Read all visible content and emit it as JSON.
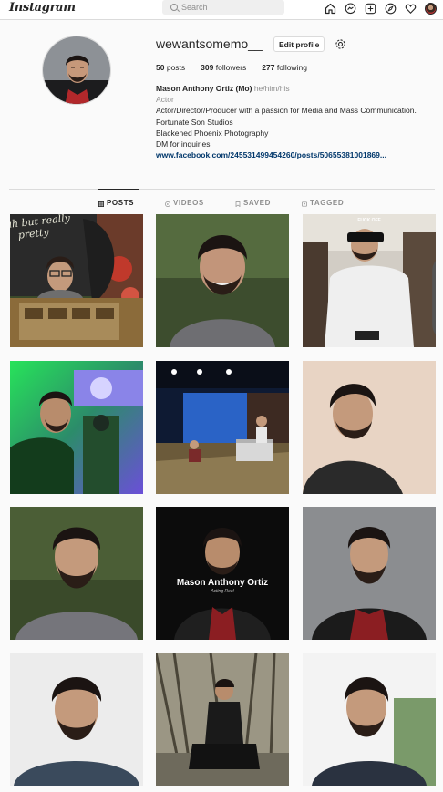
{
  "nav": {
    "logo": "Instagram",
    "search_placeholder": "Search",
    "icons": [
      "home-icon",
      "messenger-icon",
      "new-post-icon",
      "explore-icon",
      "activity-heart-icon",
      "profile-avatar-icon"
    ]
  },
  "profile": {
    "username": "wewantsomemo__",
    "edit_label": "Edit profile",
    "posts_count": "50",
    "posts_label": "posts",
    "followers_count": "309",
    "followers_label": "followers",
    "following_count": "277",
    "following_label": "following",
    "full_name": "Mason Anthony Ortiz (Mo)",
    "pronouns": "he/him/his",
    "category": "Actor",
    "bio_lines": [
      "Actor/Director/Producer with a passion for Media and Mass Communication.",
      "Fortunate Son Studios",
      "Blackened Phoenix Photography",
      "DM for inquiries"
    ],
    "link": "www.facebook.com/245531499454260/posts/50655381001869..."
  },
  "tabs": [
    {
      "label": "POSTS",
      "icon": "grid-icon",
      "active": true
    },
    {
      "label": "VIDEOS",
      "icon": "video-icon",
      "active": false
    },
    {
      "label": "SAVED",
      "icon": "bookmark-icon",
      "active": false
    },
    {
      "label": "TAGGED",
      "icon": "tag-icon",
      "active": false
    }
  ],
  "posts": [
    {
      "caption": "yeah but really pretty",
      "badge": ""
    },
    {
      "caption": "",
      "badge": ""
    },
    {
      "caption": "FUCK OFF",
      "badge": "carousel-icon"
    },
    {
      "caption": "",
      "badge": ""
    },
    {
      "caption": "",
      "badge": ""
    },
    {
      "caption": "",
      "badge": "video-icon"
    },
    {
      "caption": "",
      "badge": ""
    },
    {
      "caption": "Mason Anthony Ortiz",
      "subcaption": "Acting Reel",
      "badge": "video-icon"
    },
    {
      "caption": "",
      "badge": ""
    },
    {
      "caption": "",
      "badge": ""
    },
    {
      "caption": "",
      "badge": ""
    },
    {
      "caption": "",
      "badge": ""
    }
  ],
  "colors": {
    "link": "#00376b",
    "border": "#dbdbdb",
    "muted": "#8e8e8e",
    "text": "#262626"
  }
}
